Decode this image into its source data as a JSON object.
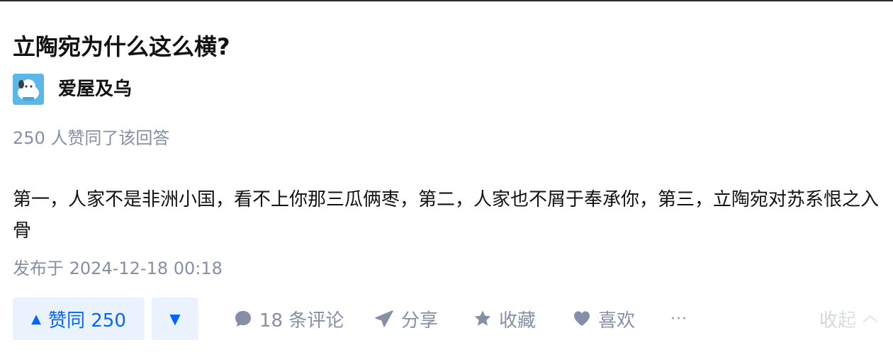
{
  "question": {
    "title": "立陶宛为什么这么横?"
  },
  "author": {
    "name": "爱屋及乌",
    "avatar_icon": "cartoon-dog-avatar-icon"
  },
  "answer": {
    "vote_summary": "250 人赞同了该回答",
    "body": "第一，人家不是非洲小国，看不上你那三瓜俩枣，第二，人家也不屑于奉承你，第三，立陶宛对苏系恨之入骨",
    "published": "发布于 2024-12-18 00:18"
  },
  "actions": {
    "upvote_label": "赞同 250",
    "upvote_icon": "▲",
    "downvote_icon": "▼",
    "comment_label": "18 条评论",
    "share_label": "分享",
    "collect_label": "收藏",
    "like_label": "喜欢",
    "more_label": "···",
    "collapse_label": "收起"
  },
  "colors": {
    "accent": "#0066ff",
    "vote_bg": "#eaf2fe",
    "muted": "#8590a6",
    "text": "#121212"
  }
}
